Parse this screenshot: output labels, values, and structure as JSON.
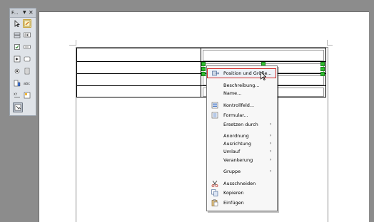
{
  "toolbar": {
    "title": "F...",
    "dropdown_glyph": "▼",
    "close_glyph": "✕",
    "buttons": [
      {
        "name": "select-icon"
      },
      {
        "name": "design-mode-icon"
      },
      {
        "name": "push-button-icon"
      },
      {
        "name": "option-button-icon"
      },
      {
        "name": "checkbox-icon"
      },
      {
        "name": "text-box-icon"
      },
      {
        "name": "list-box-icon"
      },
      {
        "name": "group-box-icon"
      },
      {
        "name": "combo-box-icon"
      },
      {
        "name": "label-field-icon"
      },
      {
        "name": "more-controls-icon"
      },
      {
        "name": "form-design-icon"
      },
      {
        "name": "wizards-icon"
      }
    ]
  },
  "context_menu": {
    "items": [
      {
        "label": "Position und Größe...",
        "icon": "position-size-icon",
        "highlighted": true
      },
      {
        "label": "Beschreibung..."
      },
      {
        "label": "Name..."
      },
      {
        "label": "Kontrollfeld...",
        "icon": "control-field-icon"
      },
      {
        "label": "Formular...",
        "icon": "form-icon"
      },
      {
        "label": "Ersetzen durch",
        "submenu": true
      },
      {
        "label": "Anordnung",
        "submenu": true
      },
      {
        "label": "Ausrichtung",
        "submenu": true
      },
      {
        "label": "Umlauf",
        "submenu": true
      },
      {
        "label": "Verankerung",
        "submenu": true
      },
      {
        "label": "Gruppe",
        "submenu": true
      },
      {
        "label": "Ausschneiden",
        "icon": "cut-icon"
      },
      {
        "label": "Kopieren",
        "icon": "copy-icon"
      },
      {
        "label": "Einfügen",
        "icon": "paste-icon"
      }
    ],
    "submenu_arrow": "›"
  }
}
